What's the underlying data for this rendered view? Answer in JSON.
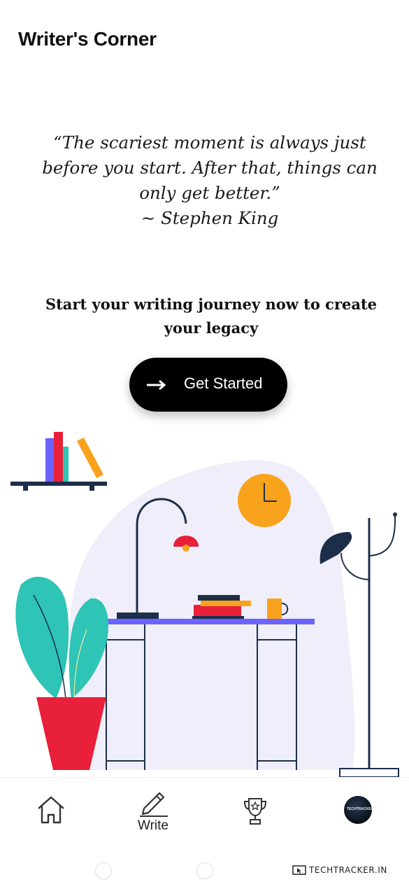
{
  "header": {
    "title": "Writer's Corner"
  },
  "quote": {
    "text": "“The scariest moment is always just before you start. After that, things can only get better.”",
    "author": "~ Stephen King"
  },
  "tagline": "Start your writing journey now to create your legacy",
  "cta": {
    "label": "Get Started",
    "icon": "arrow-right-icon"
  },
  "bottom_nav": {
    "items": [
      {
        "name": "home",
        "icon": "home-icon",
        "label": ""
      },
      {
        "name": "write",
        "icon": "pencil-icon",
        "label": "Write",
        "active": true
      },
      {
        "name": "leaderboard",
        "icon": "trophy-icon",
        "label": ""
      },
      {
        "name": "profile",
        "icon": "avatar",
        "label": ""
      }
    ]
  },
  "avatar_text": "TECHTRACKER",
  "watermark": "TECHTRACKER.IN",
  "colors": {
    "background": "#ffffff",
    "button": "#000000",
    "blob": "#efeefa",
    "accent_purple": "#6c63ff",
    "accent_red": "#e8203a",
    "accent_orange": "#f9a21b",
    "accent_teal": "#2ec4b6",
    "navy": "#1d2e4a"
  }
}
